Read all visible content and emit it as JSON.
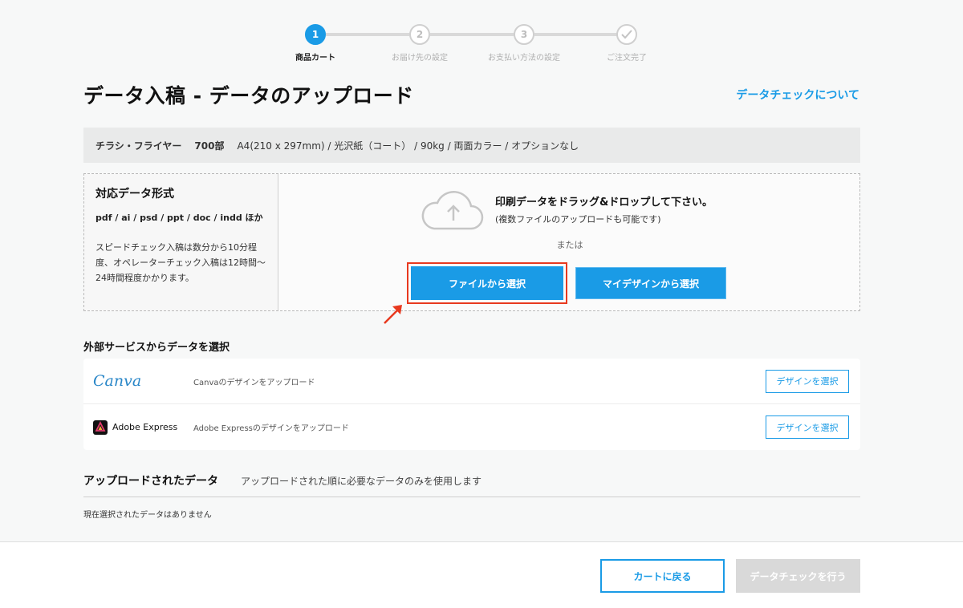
{
  "stepper": {
    "steps": [
      {
        "number": "1",
        "label": "商品カート",
        "active": true
      },
      {
        "number": "2",
        "label": "お届け先の設定",
        "active": false
      },
      {
        "number": "3",
        "label": "お支払い方法の設定",
        "active": false
      },
      {
        "number": "check-icon",
        "label": "ご注文完了",
        "active": false
      }
    ]
  },
  "header": {
    "title": "データ入稿 - データのアップロード",
    "about_link": "データチェックについて"
  },
  "product": {
    "name": "チラシ・フライヤー",
    "quantity": "700部",
    "spec": "A4(210 x 297mm) / 光沢紙（コート） / 90kg / 両面カラー / オプションなし"
  },
  "formats": {
    "title": "対応データ形式",
    "list": "pdf / ai / psd / ppt / doc / indd ほか",
    "description": "スピードチェック入稿は数分から10分程度、オペレーターチェック入稿は12時間〜24時間程度かかります。"
  },
  "dropzone": {
    "main_text": "印刷データをドラッグ&ドロップして下さい。",
    "sub_text": "(複数ファイルのアップロードも可能です)",
    "or_text": "または",
    "file_button": "ファイルから選択",
    "mydesign_button": "マイデザインから選択"
  },
  "external": {
    "title": "外部サービスからデータを選択",
    "services": [
      {
        "logo": "Canva",
        "description": "Canvaのデザインをアップロード",
        "button": "デザインを選択"
      },
      {
        "logo": "Adobe Express",
        "description": "Adobe Expressのデザインをアップロード",
        "button": "デザインを選択"
      }
    ]
  },
  "uploaded": {
    "title": "アップロードされたデータ",
    "note": "アップロードされた順に必要なデータのみを使用します",
    "empty_text": "現在選択されたデータはありません"
  },
  "footer": {
    "back_button": "カートに戻る",
    "check_button": "データチェックを行う"
  },
  "colors": {
    "accent": "#1a9be6",
    "highlight": "#e8391f",
    "disabled": "#d9d9d9"
  }
}
